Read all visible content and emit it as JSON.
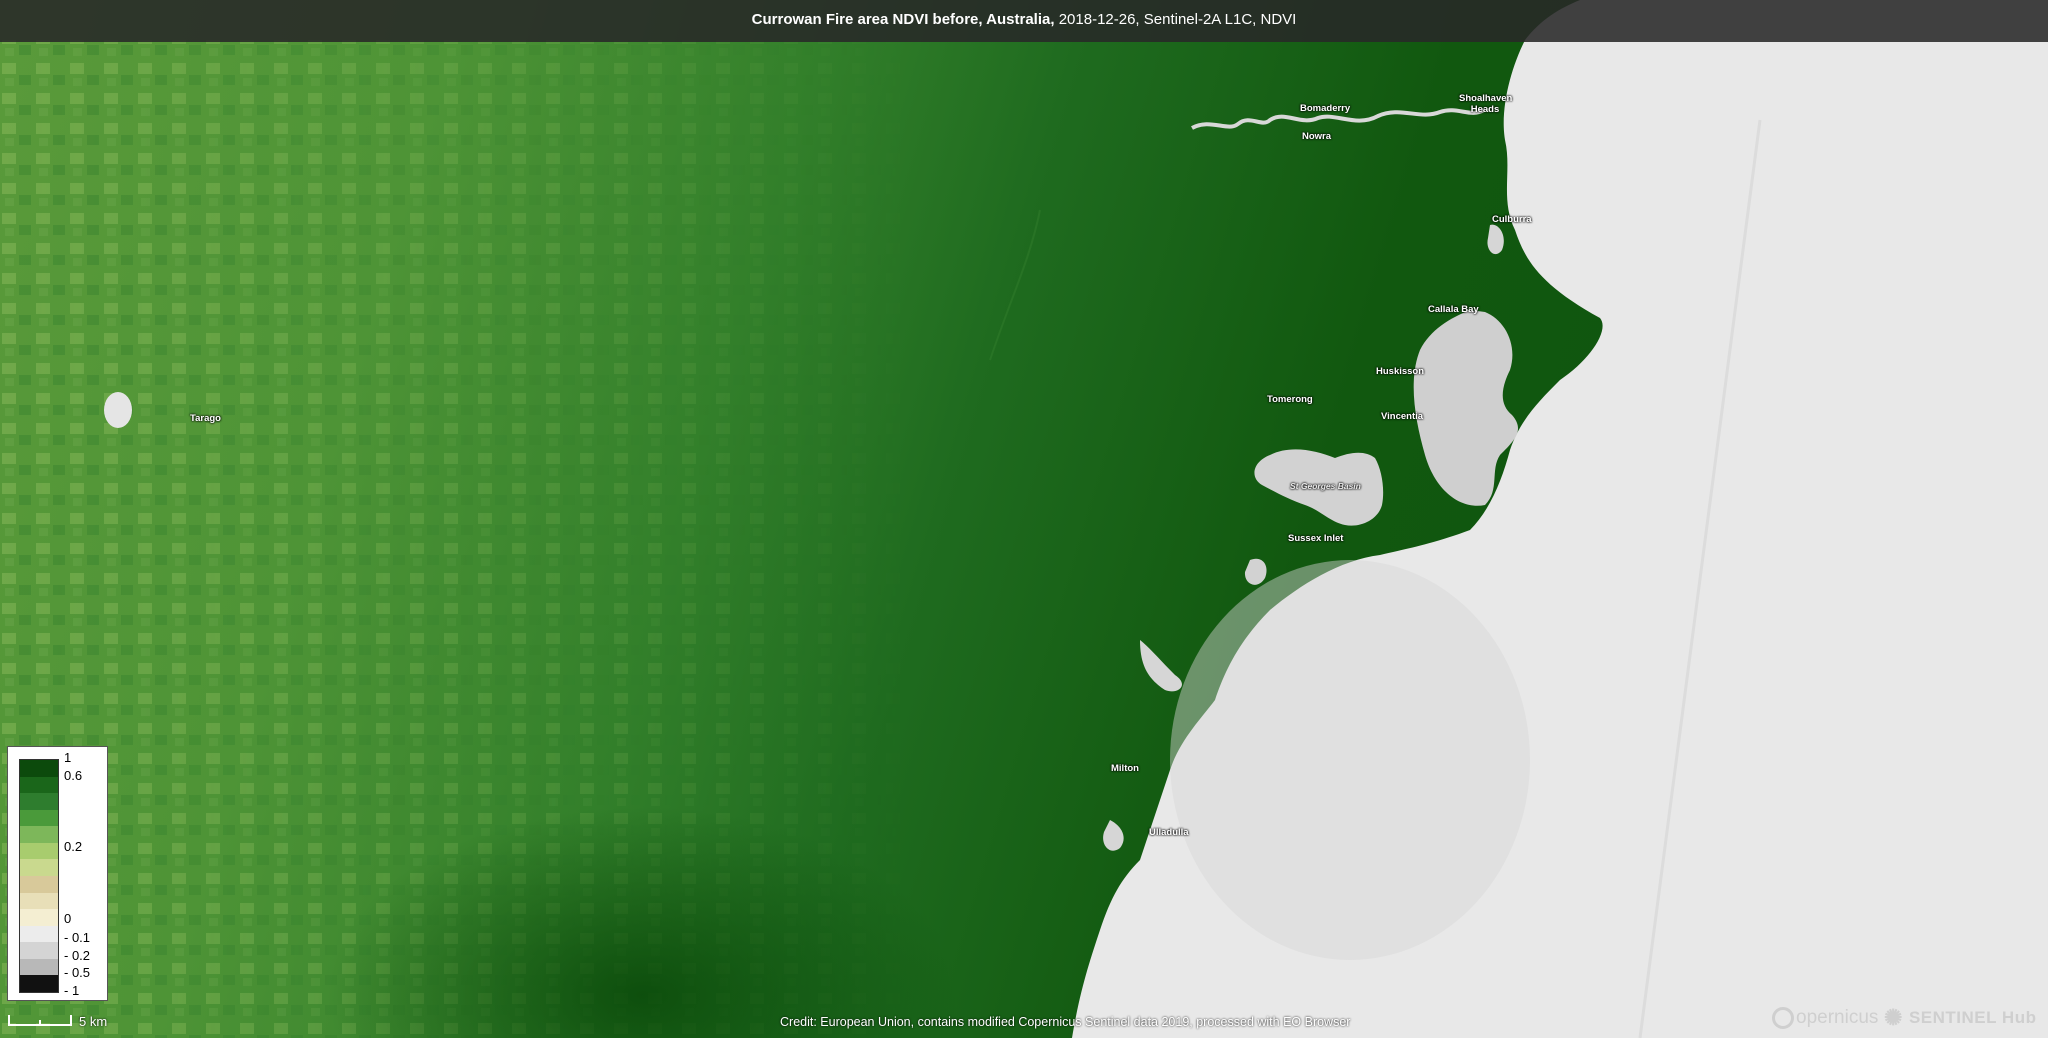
{
  "title": {
    "bold": "Currowan Fire area NDVI before, Australia,",
    "rest": " 2018-12-26, Sentinel-2A L1C, NDVI"
  },
  "places": {
    "bomaderry": "Bomaderry",
    "nowra": "Nowra",
    "shoalhaven": "Shoalhaven Heads",
    "culburra": "Culburra",
    "callala": "Callala Bay",
    "huskisson": "Huskisson",
    "tomerong": "Tomerong",
    "vincentia": "Vincentia",
    "st_georges": "St Georges Basin",
    "sussex": "Sussex Inlet",
    "milton": "Milton",
    "ulladulla": "Ulladulla",
    "tarago": "Tarago"
  },
  "legend": {
    "ticks": [
      "1",
      "0.6",
      "0.2",
      "0",
      "- 0.1",
      "- 0.2",
      "- 0.5",
      "- 1"
    ],
    "colors": [
      "#0c4a0c",
      "#1a661a",
      "#2e7d2e",
      "#4a9a3a",
      "#7db75a",
      "#a8cc6e",
      "#c9d98e",
      "#d8c99a",
      "#e8dfb8",
      "#f4eed2",
      "#ececec",
      "#d4d4d4",
      "#b8b8b8",
      "#111111"
    ]
  },
  "scale": {
    "label": "5 km"
  },
  "credit": "Credit: European Union, contains modified Copernicus Sentinel data 2019, processed with EO Browser",
  "logos": {
    "copernicus": "opernicus",
    "sentinel_hub": "SENTINEL Hub"
  }
}
